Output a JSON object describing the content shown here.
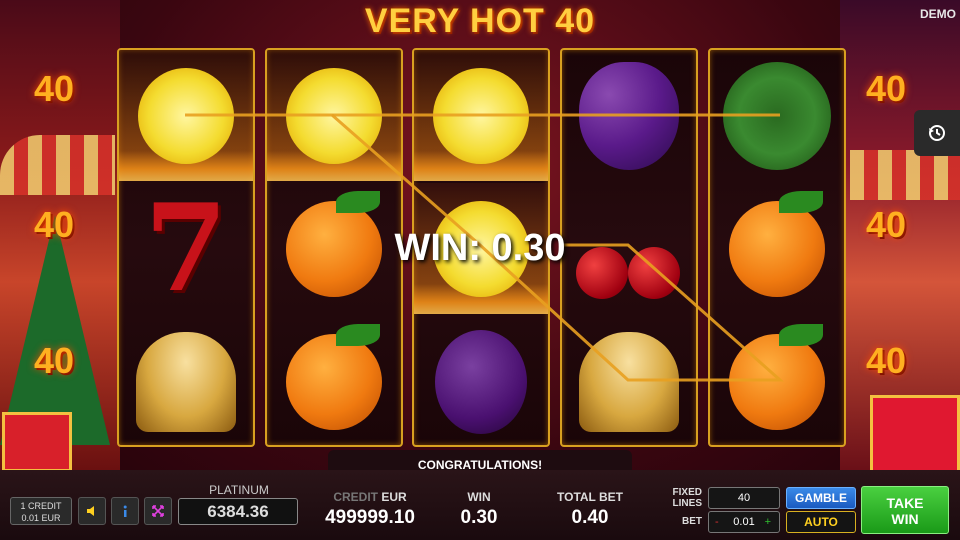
{
  "game": {
    "title": "VERY HOT 40",
    "mode": "DEMO"
  },
  "side_numbers": [
    "40",
    "40",
    "40",
    "40",
    "40",
    "40"
  ],
  "reels": [
    [
      "lemon",
      "seven",
      "bell"
    ],
    [
      "lemon",
      "orange",
      "orange"
    ],
    [
      "lemon",
      "lemon",
      "plum"
    ],
    [
      "grapes",
      "cherries",
      "bell"
    ],
    [
      "watermelon",
      "orange",
      "orange"
    ]
  ],
  "winning_symbols": [
    [
      0,
      0
    ],
    [
      1,
      0
    ],
    [
      2,
      0
    ],
    [
      2,
      1
    ]
  ],
  "win_overlay": "WIN: 0.30",
  "message": "CONGRATULATIONS!",
  "controls": {
    "credit_button": {
      "line1": "1 CREDIT",
      "line2": "0.01 EUR"
    },
    "sound_icon": "speaker-icon",
    "info_icon": "info-icon",
    "fullscreen_icon": "fullscreen-icon",
    "history_icon": "history-icon"
  },
  "jackpot": {
    "label": "PLATINUM JACKPOT",
    "value": "6384.36"
  },
  "credit": {
    "label": "CREDIT",
    "currency": "EUR",
    "value": "499999.10"
  },
  "win": {
    "label": "WIN",
    "value": "0.30"
  },
  "total_bet": {
    "label": "TOTAL BET",
    "value": "0.40"
  },
  "fixed_lines": {
    "label_line1": "FIXED",
    "label_line2": "LINES",
    "value": "40"
  },
  "bet": {
    "label": "BET",
    "value": "0.01",
    "minus": "-",
    "plus": "+"
  },
  "buttons": {
    "gamble": "GAMBLE",
    "auto": "AUTO",
    "take_win_line1": "TAKE",
    "take_win_line2": "WIN"
  },
  "colors": {
    "reel_border": "#d8a020",
    "gamble": "#2a72d8",
    "take_win": "#2ab828",
    "title": "#ffcf40"
  }
}
